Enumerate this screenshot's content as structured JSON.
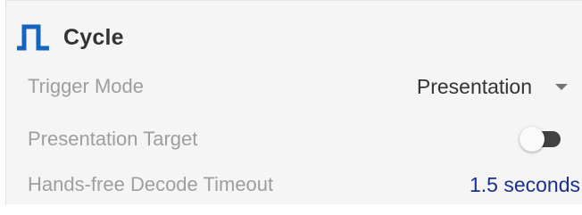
{
  "section": {
    "title": "Cycle",
    "icon": "square-wave-icon",
    "accent_color": "#1565c0"
  },
  "settings": {
    "trigger_mode": {
      "label": "Trigger Mode",
      "value": "Presentation"
    },
    "presentation_target": {
      "label": "Presentation Target",
      "enabled": false
    },
    "hands_free_timeout": {
      "label": "Hands-free Decode Timeout",
      "value": "1.5 seconds",
      "value_color": "#1a2f8f"
    }
  }
}
